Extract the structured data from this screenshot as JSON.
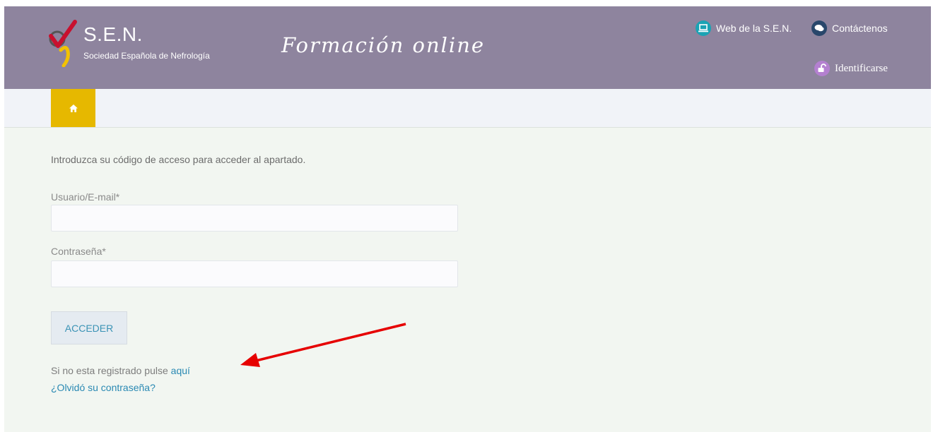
{
  "header": {
    "logo_title": "S.E.N.",
    "logo_subtitle": "Sociedad Española de Nefrología",
    "tagline": "Formación online",
    "links": {
      "web": "Web de la S.E.N.",
      "contact": "Contáctenos",
      "login": "Identificarse"
    },
    "icons": {
      "web": "laptop-icon",
      "contact": "chat-icon",
      "login": "unlock-icon"
    },
    "colors": {
      "header_bg": "#8e849e",
      "web_icon_bg": "#1aa3b4",
      "contact_icon_bg": "#29476b",
      "login_icon_bg": "#b480d0"
    }
  },
  "nav": {
    "home_icon": "home-icon",
    "home_color": "#e6b800"
  },
  "form": {
    "intro": "Introduzca su código de acceso para acceder al apartado.",
    "user_label": "Usuario/E-mail*",
    "user_value": "",
    "pass_label": "Contraseña*",
    "pass_value": "",
    "submit": "ACCEDER",
    "register_text": "Si no esta registrado pulse",
    "register_link": "aquí",
    "forgot_link": "¿Olvidó su contraseña?"
  },
  "annotation": {
    "arrow_color": "#e60000"
  }
}
